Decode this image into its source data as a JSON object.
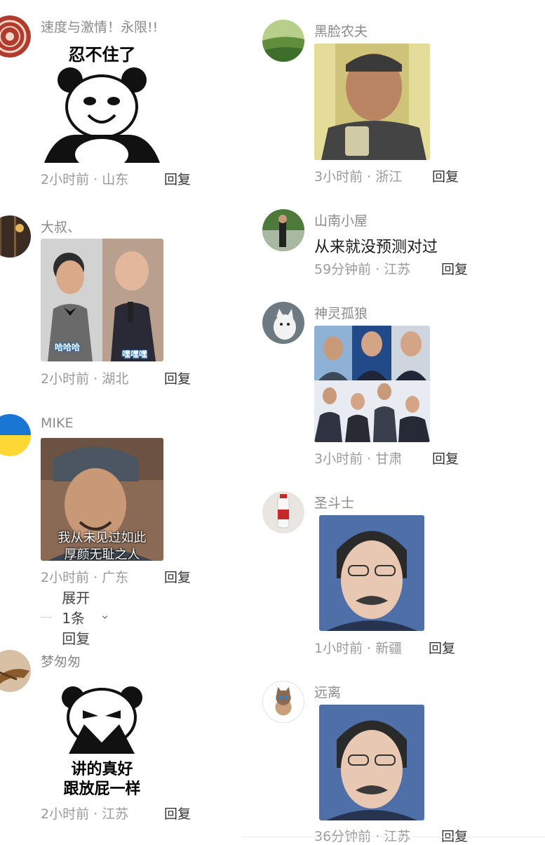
{
  "comments": [
    {
      "username": "速度与激情！永限!!",
      "meme_text": "忍不住了",
      "time": "2小时前",
      "location": "山东",
      "reply_label": "回复"
    },
    {
      "username": "大叔、",
      "tag_left": "哈哈哈",
      "tag_right": "嘿嘿嘿",
      "time": "2小时前",
      "location": "湖北",
      "reply_label": "回复"
    },
    {
      "username": "MIKE",
      "subtitle_line1": "我从未见过如此",
      "subtitle_line2": "厚颜无耻之人",
      "time": "2小时前",
      "location": "广东",
      "reply_label": "回复",
      "expand_label": "展开1条回复"
    },
    {
      "username": "梦匆匆",
      "meme_line1": "讲的真好",
      "meme_line2": "跟放屁一样",
      "time": "2小时前",
      "location": "江苏",
      "reply_label": "回复"
    },
    {
      "username": "黑脸农夫",
      "time": "3小时前",
      "location": "浙江",
      "reply_label": "回复"
    },
    {
      "username": "山南小屋",
      "text": "从来就没预测对过",
      "time": "59分钟前",
      "location": "江苏",
      "reply_label": "回复"
    },
    {
      "username": "神灵孤狼",
      "time": "3小时前",
      "location": "甘肃",
      "reply_label": "回复"
    },
    {
      "username": "圣斗士",
      "time": "1小时前",
      "location": "新疆",
      "reply_label": "回复"
    },
    {
      "username": "远离",
      "time": "36分钟前",
      "location": "江苏",
      "reply_label": "回复"
    }
  ],
  "meta_separator": "·",
  "colors": {
    "meta_text": "#9a9a9a",
    "username": "#8a8a8a",
    "accent_blue": "#1565c0"
  }
}
